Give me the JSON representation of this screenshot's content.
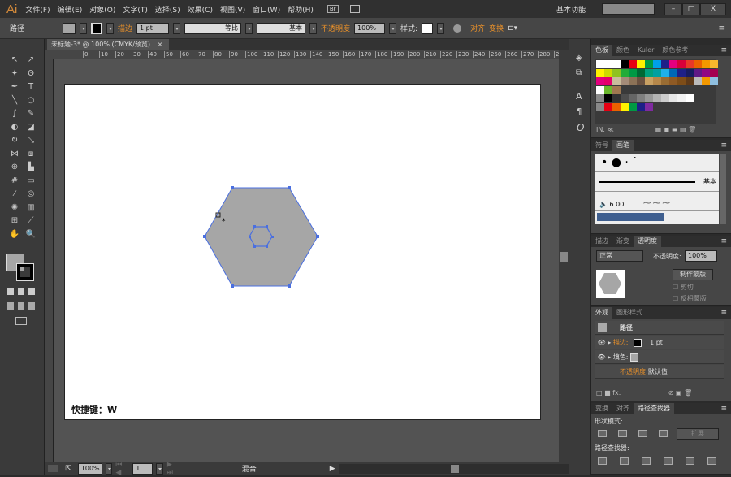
{
  "app": {
    "logo": "Ai",
    "workspace": "基本功能",
    "search_placeholder": "",
    "window_buttons": [
      "–",
      "□",
      "X"
    ]
  },
  "menu": [
    "文件(F)",
    "编辑(E)",
    "对象(O)",
    "文字(T)",
    "选择(S)",
    "效果(C)",
    "视图(V)",
    "窗口(W)",
    "帮助(H)"
  ],
  "menu_icons": {
    "bridge": "Br",
    "arrange": "arrange-documents-icon"
  },
  "control": {
    "object_type": "路径",
    "stroke_label": "描边",
    "stroke_weight": "1 pt",
    "profile": "等比",
    "brush": "基本",
    "opacity_label": "不透明度",
    "opacity": "100%",
    "style_label": "样式:",
    "align": "对齐",
    "transform": "变换"
  },
  "document": {
    "tab": "未标题-3* @ 100% (CMYK/预览)",
    "close": "×",
    "hint": "快捷键：W"
  },
  "ruler_ticks": [
    "0",
    "10",
    "20",
    "30",
    "40",
    "50",
    "60",
    "70",
    "80",
    "90",
    "100",
    "110",
    "120",
    "130",
    "140",
    "150",
    "160",
    "170",
    "180",
    "190",
    "200",
    "210",
    "220",
    "230",
    "240",
    "250",
    "260",
    "270",
    "280",
    "290",
    "300"
  ],
  "status": {
    "zoom": "100%",
    "artboard": "1",
    "mode": "混合"
  },
  "swatches": {
    "tabs": [
      "色板",
      "颜色",
      "Kuler",
      "颜色参考"
    ],
    "rows": [
      [
        "#ffffff",
        "#ffffff",
        "#ffffff",
        "#000000",
        "#e60012",
        "#fff100",
        "#009944",
        "#00a0e9",
        "#1d2088",
        "#e4007f",
        "#d7003a",
        "#e83828",
        "#eb6100",
        "#f39800",
        "#f8b62d"
      ],
      [
        "#fff100",
        "#cfdb00",
        "#8fc31f",
        "#22ac38",
        "#009944",
        "#006934",
        "#00a17c",
        "#00a0a0",
        "#1fb0e8",
        "#0068b7",
        "#1d2088",
        "#171c61",
        "#601986",
        "#920783",
        "#a40050"
      ],
      [
        "#e4007f",
        "#e5006a",
        "#c9bc9c",
        "#a48b78",
        "#8c7257",
        "#6a5140",
        "#c8a063",
        "#b5874a",
        "#996c33",
        "#8f5a24",
        "#7e4d18",
        "#5e3a19",
        "#bbbbbb",
        "#f39800",
        "#8fbfe0"
      ],
      [
        "#ffffff",
        "#6ab72c",
        "#a07850"
      ],
      [
        "#888888",
        "#000000",
        "#333333",
        "#4d4d4d",
        "#666666",
        "#808080",
        "#999999",
        "#b3b3b3",
        "#cccccc",
        "#e6e6e6",
        "#f2f2f2",
        "#ffffff"
      ],
      [
        "#888888",
        "#e60012",
        "#eb6100",
        "#fff100",
        "#009944",
        "#1d2088",
        "#7f2aa0"
      ]
    ]
  },
  "brushes": {
    "tabs": [
      "符号",
      "画笔"
    ],
    "basic": "基本",
    "size": "6.00"
  },
  "transparency": {
    "tabs": [
      "描边",
      "渐变",
      "透明度"
    ],
    "mode": "正常",
    "opacity_label": "不透明度:",
    "opacity": "100%",
    "make_mask": "制作蒙版",
    "clip": "剪切",
    "invert": "反相蒙版"
  },
  "appearance": {
    "tabs": [
      "外观",
      "图形样式"
    ],
    "title": "路径",
    "stroke_label": "描边:",
    "stroke_value": "1 pt",
    "fill_label": "填色:",
    "opacity_label": "不透明度:",
    "opacity_value": "默认值"
  },
  "pathfinder": {
    "tabs": [
      "变换",
      "对齐",
      "路径查找器"
    ],
    "shape_modes": "形状模式:",
    "expand": "扩展",
    "pathfinders": "路径查找器:"
  },
  "colors": {
    "accent": "#e8902a",
    "selection": "#4a6fe0",
    "shape_fill": "#a6a6a6"
  }
}
